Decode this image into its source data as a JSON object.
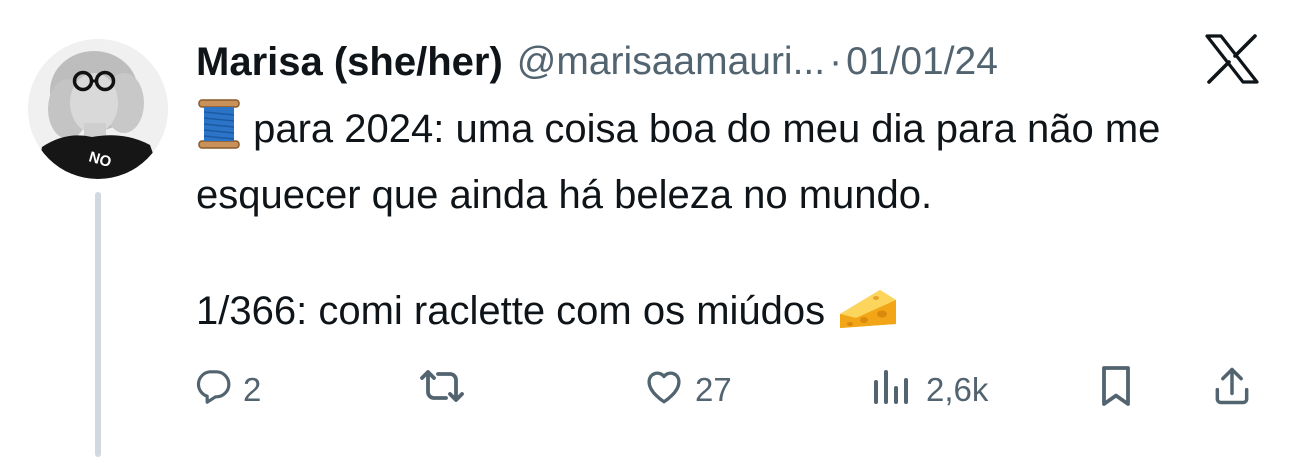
{
  "author": {
    "name": "Marisa (she/her)",
    "handle": "@marisaamauri...",
    "separator": "·",
    "date": "01/01/24",
    "avatar_shirt_text": "NO"
  },
  "platform_icon": "x-logo-icon",
  "tweet": {
    "lines": [
      {
        "emoji": "spool-of-thread-emoji",
        "text": " para 2024: uma coisa boa do meu dia para não me esquecer que ainda há beleza no mundo."
      },
      {
        "text": "1/366: comi raclette com os miúdos ",
        "emoji": "cheese-wedge-emoji"
      }
    ]
  },
  "actions": {
    "reply": {
      "icon": "reply-icon",
      "count": "2"
    },
    "retweet": {
      "icon": "retweet-icon",
      "count": ""
    },
    "like": {
      "icon": "heart-icon",
      "count": "27"
    },
    "views": {
      "icon": "views-icon",
      "count": "2,6k"
    },
    "bookmark": {
      "icon": "bookmark-icon"
    },
    "share": {
      "icon": "share-icon"
    }
  },
  "colors": {
    "text_primary": "#0f1419",
    "text_secondary": "#536471",
    "thread_line": "#cfd9de",
    "background": "#ffffff"
  }
}
